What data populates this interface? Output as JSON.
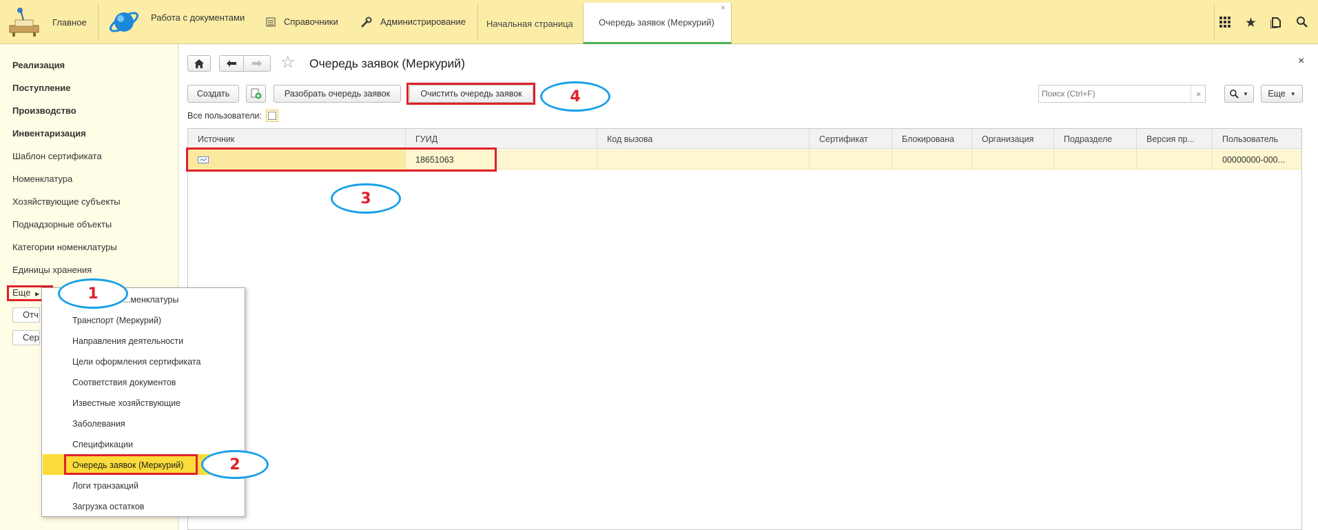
{
  "topbar": {
    "home_label": "Главное",
    "docs_label": "Работа с документами",
    "refs_label": "Справочники",
    "admin_label": "Администрирование",
    "tabs": [
      {
        "label": "Начальная страница"
      },
      {
        "label": "Очередь заявок (Меркурий)",
        "close": "×"
      }
    ]
  },
  "sidebar": {
    "items": [
      {
        "label": "Реализация"
      },
      {
        "label": "Поступление"
      },
      {
        "label": "Производство"
      },
      {
        "label": "Инвентаризация"
      },
      {
        "label": "Шаблон сертификата"
      },
      {
        "label": "Номенклатура"
      },
      {
        "label": "Хозяйствующие субъекты"
      },
      {
        "label": "Поднадзорные объекты"
      },
      {
        "label": "Категории номенклатуры"
      },
      {
        "label": "Единицы хранения"
      }
    ],
    "more_label": "Еще",
    "reports_label": "Отч",
    "service_label": "Серв"
  },
  "content": {
    "title": "Очередь заявок (Меркурий)",
    "close_symbol": "×",
    "create_label": "Создать",
    "parse_label": "Разобрать очередь заявок",
    "clear_label": "Очистить очередь заявок",
    "search_placeholder": "Поиск (Ctrl+F)",
    "search_clear": "×",
    "more_label": "Еще",
    "all_users_label": "Все пользователи:"
  },
  "table": {
    "columns": [
      "Источник",
      "ГУИД",
      "Код вызова",
      "Сертификат",
      "Блокирована",
      "Организация",
      "Подразделе",
      "Версия пр...",
      "Пользователь"
    ],
    "rows": [
      {
        "guid": "18651063",
        "user": "00000000-000..."
      }
    ]
  },
  "popup": {
    "items": [
      {
        "label": "...менклатуры"
      },
      {
        "label": "Транспорт (Меркурий)"
      },
      {
        "label": "Направления деятельности"
      },
      {
        "label": "Цели оформления сертификата"
      },
      {
        "label": "Соответствия документов"
      },
      {
        "label": "Известные хозяйствующие"
      },
      {
        "label": "Заболевания"
      },
      {
        "label": "Спецификации"
      },
      {
        "label": "Очередь заявок (Меркурий)"
      },
      {
        "label": "Логи транзакций"
      },
      {
        "label": "Загрузка остатков"
      }
    ]
  },
  "annotations": {
    "one": "1",
    "two": "2",
    "three": "3",
    "four": "4"
  },
  "colors": {
    "topbar": "#fbeda6",
    "sidebar": "#fffde6",
    "highlight": "#fbdc3a",
    "selected_row": "#fdf6cf",
    "annotation_red": "#e0202a",
    "annotation_blue": "#1aa0e8"
  },
  "icons": [
    "home-desk-icon",
    "planet-logo-icon",
    "list-icon",
    "wrench-icon",
    "apps-grid-icon",
    "star-icon",
    "history-icon",
    "search-icon",
    "back-arrow-icon",
    "forward-arrow-icon",
    "favorite-star-icon",
    "add-copy-icon",
    "row-source-icon"
  ]
}
